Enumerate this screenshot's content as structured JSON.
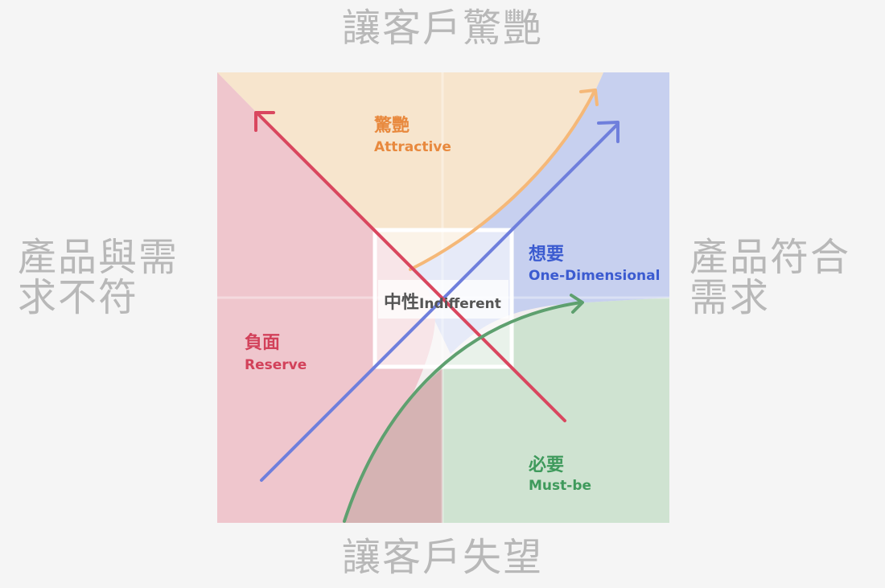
{
  "axes": {
    "top": "讓客戶驚艷",
    "bottom": "讓客戶失望",
    "left": "產品與需求不符",
    "right": "產品符合需求"
  },
  "zones": {
    "attractive": {
      "zh": "驚艷",
      "en": "Attractive",
      "color": "#e8893e"
    },
    "one_dimensional": {
      "zh": "想要",
      "en": "One-Dimensional",
      "color": "#3b5bd0"
    },
    "reserve": {
      "zh": "負面",
      "en": "Reserve",
      "color": "#d2415a"
    },
    "must_be": {
      "zh": "必要",
      "en": "Must-be",
      "color": "#3f9a5c"
    },
    "indifferent": {
      "zh": "中性",
      "en": "Indifferent",
      "color": "#555555"
    }
  },
  "colors": {
    "attractive_fill": "#f7e5cd",
    "one_dimensional_fill": "#c7d0ef",
    "reserve_fill": "#efc6cd",
    "must_be_fill": "#cfe3d1",
    "overlap_fill": "#d5b3b3",
    "attractive_line": "#f5b878",
    "one_dimensional_line": "#6f7fdc",
    "reserve_line": "#d9475f",
    "must_be_line": "#5ea06f"
  }
}
